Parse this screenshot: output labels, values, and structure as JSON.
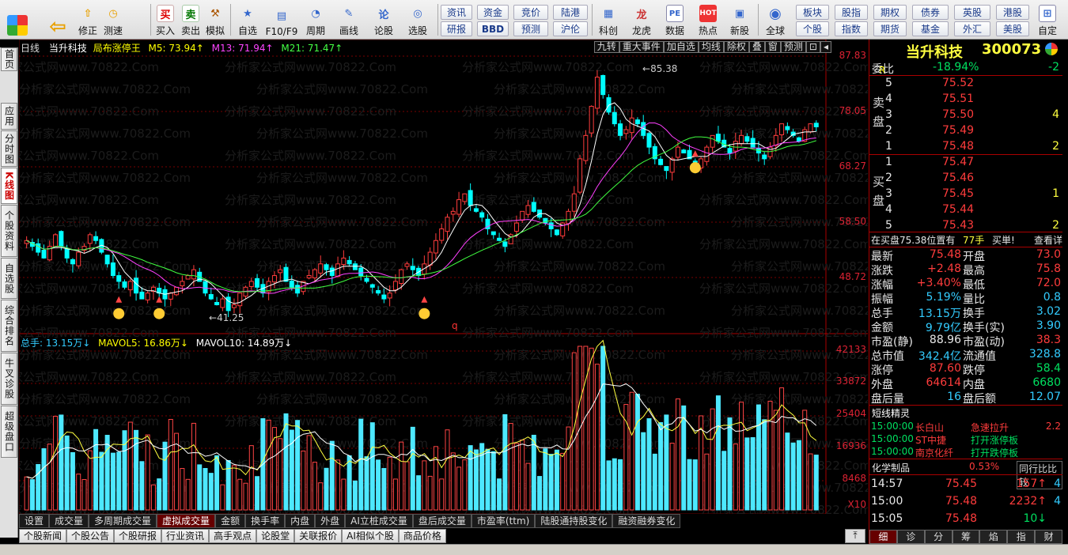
{
  "toolbar": {
    "buttons": [
      {
        "label": "",
        "icon": "logo-icon"
      },
      {
        "label": "",
        "icon": "back-arrow-icon"
      },
      {
        "label": "修正",
        "icon": "up-arrow-icon"
      },
      {
        "label": "测速",
        "icon": "clock-icon"
      },
      {
        "label": "买入",
        "icon": "buy-icon"
      },
      {
        "label": "卖出",
        "icon": "sell-icon"
      },
      {
        "label": "模拟",
        "icon": "hammer-icon"
      },
      {
        "label": "自选",
        "icon": "star-icon"
      },
      {
        "label": "F10/F9",
        "icon": "f10-icon"
      },
      {
        "label": "周期",
        "icon": "cycle-icon"
      },
      {
        "label": "画线",
        "icon": "pencil-icon"
      },
      {
        "label": "论股",
        "icon": "forum-icon"
      },
      {
        "label": "选股",
        "icon": "select-stock-icon"
      },
      {
        "label": "科创",
        "icon": "kechuang-icon"
      },
      {
        "label": "龙虎",
        "icon": "dragon-tiger-icon"
      },
      {
        "label": "数据",
        "icon": "pe-icon"
      },
      {
        "label": "热点",
        "icon": "hot-icon"
      },
      {
        "label": "新股",
        "icon": "ipo-icon"
      },
      {
        "label": "全球",
        "icon": "globe-icon"
      },
      {
        "label": "自定",
        "icon": "custom-icon"
      }
    ],
    "small_top": [
      "资讯",
      "资金",
      "竞价",
      "陆港"
    ],
    "small_bottom": [
      "研报",
      "BBD",
      "预测",
      "沪伦"
    ],
    "right_top": [
      "板块",
      "股指",
      "期权",
      "债券",
      "英股",
      "港股"
    ],
    "right_bottom": [
      "个股",
      "指数",
      "期货",
      "基金",
      "外汇",
      "美股"
    ]
  },
  "lefttabs": [
    "首页",
    "应用",
    "分时图",
    "K线图",
    "个股资料",
    "自选股",
    "综合排名",
    "牛叉诊股",
    "超级盘口"
  ],
  "chart": {
    "period": "日线",
    "stock": "当升科技",
    "indicator": "局布涨停王",
    "ma5": "M5: 73.94↑",
    "ma13": "M13: 71.94↑",
    "ma21": "M21: 71.47↑",
    "buttons": [
      "九转",
      "重大事件",
      "加自选",
      "均线",
      "除权",
      "叠",
      "窗",
      "预测"
    ],
    "price_axis": [
      "87.83",
      "78.05",
      "68.27",
      "58.50",
      "48.72"
    ],
    "vol_axis": [
      "42133",
      "33872",
      "25404",
      "16936",
      "8468",
      "X10"
    ],
    "high_label": "85.38",
    "low_label": "41.25",
    "q_mark": "q",
    "vol_header": {
      "total": "总手: 13.15万↓",
      "mavol5": "MAVOL5: 16.86万↓",
      "mavol10": "MAVOL10: 14.89万↓"
    },
    "watermark": "分析家公式网www.70822.Com",
    "colors": {
      "up": "#ff3c3c",
      "down": "#00ffff",
      "ma5": "#ffffff",
      "ma13": "#ff40ff",
      "ma21": "#40ff40",
      "vol_up": "#ff4444",
      "vol_down": "#4de8ff"
    }
  },
  "chart_data": {
    "type": "candlestick",
    "series_desc": "daily K-line with MA5/MA13/MA21 and volume",
    "ylim": [
      41,
      88
    ],
    "closes": [
      56,
      55,
      54,
      53,
      55,
      57,
      55,
      53,
      52,
      54,
      55,
      57,
      56,
      54,
      52,
      50,
      49,
      48,
      49,
      47,
      46,
      47,
      48,
      47,
      46,
      47,
      48,
      49,
      50,
      51,
      49,
      47,
      46,
      45,
      46,
      44,
      45,
      47,
      48,
      49,
      48,
      47,
      49,
      50,
      51,
      49,
      48,
      47,
      49,
      50,
      51,
      52,
      51,
      50,
      52,
      53,
      52,
      51,
      50,
      49,
      48,
      47,
      46,
      47,
      49,
      51,
      52,
      51,
      50,
      52,
      54,
      56,
      58,
      60,
      61,
      63,
      64,
      62,
      61,
      60,
      58,
      57,
      56,
      55,
      57,
      59,
      61,
      62,
      61,
      60,
      59,
      58,
      57,
      59,
      61,
      64,
      70,
      74,
      79,
      84,
      81,
      78,
      76,
      74,
      75,
      77,
      76,
      74,
      72,
      70,
      69,
      68,
      70,
      72,
      71,
      70,
      69,
      70,
      72,
      74,
      73,
      72,
      71,
      73,
      74,
      73,
      72,
      71,
      70,
      72,
      74,
      76,
      75,
      74,
      73,
      75,
      76,
      75.48
    ],
    "volume_max": 42133
  },
  "rightpanel": {
    "title": "当升科技",
    "code": "300073",
    "r_mark": "R",
    "weibi_label": "委比",
    "weibi": "-18.94%",
    "weibi_right": "-2",
    "sell_label": [
      "卖",
      "盘"
    ],
    "buy_label": [
      "买",
      "盘"
    ],
    "sells": [
      [
        "5",
        "75.52",
        ""
      ],
      [
        "4",
        "75.51",
        ""
      ],
      [
        "3",
        "75.50",
        "4"
      ],
      [
        "2",
        "75.49",
        ""
      ],
      [
        "1",
        "75.48",
        "2"
      ]
    ],
    "buys": [
      [
        "1",
        "75.47",
        ""
      ],
      [
        "2",
        "75.46",
        ""
      ],
      [
        "3",
        "75.45",
        "1"
      ],
      [
        "4",
        "75.44",
        ""
      ],
      [
        "5",
        "75.43",
        "2"
      ]
    ],
    "note": "在买盘75.38位置有",
    "note_hands": "77手",
    "note_buy": "买単!",
    "note_detail": "查看详",
    "stats": [
      [
        "最新",
        "75.48",
        "开盘",
        "73.0"
      ],
      [
        "涨跌",
        "+2.48",
        "最高",
        "75.8"
      ],
      [
        "涨幅",
        "+3.40%",
        "最低",
        "72.0"
      ],
      [
        "振幅",
        "5.19%",
        "量比",
        "0.8"
      ],
      [
        "总手",
        "13.15万",
        "换手",
        "3.02"
      ],
      [
        "金额",
        "9.79亿",
        "换手(实)",
        "3.90"
      ],
      [
        "市盈(静)",
        "88.96",
        "市盈(动)",
        "38.3"
      ],
      [
        "总市值",
        "342.4亿",
        "流通值",
        "328.8"
      ],
      [
        "涨停",
        "87.60",
        "跌停",
        "58.4"
      ],
      [
        "外盘",
        "64614",
        "内盘",
        "6680"
      ],
      [
        "盘后量",
        "16",
        "盘后额",
        "12.07"
      ]
    ],
    "sprite_title": "短线精灵",
    "sprites": [
      [
        "15:00:00",
        "长白山",
        "急速拉升",
        "2.2"
      ],
      [
        "15:00:00",
        "ST中捷",
        "打开涨停板",
        ""
      ],
      [
        "15:00:00",
        "南京化纤",
        "打开跌停板",
        ""
      ]
    ],
    "sector": "化学制品",
    "sector_pct": "0.53%",
    "sector_more": "同行比比较",
    "ticks": [
      [
        "14:57",
        "75.45",
        "157↑",
        "4"
      ],
      [
        "15:00",
        "75.48",
        "2232↑",
        "4"
      ],
      [
        "15:05",
        "75.48",
        "10↓",
        ""
      ]
    ],
    "bottom_tabs": [
      "细",
      "诊",
      "分",
      "筹",
      "焰",
      "指",
      "财"
    ]
  },
  "bottom_tabs_1": [
    "设置",
    "成交量",
    "多周期成交量",
    "虚拟成交量",
    "金额",
    "换手率",
    "内盘",
    "外盘",
    "AI立桩成交量",
    "盘后成交量",
    "市盈率(ttm)",
    "陆股通持股变化",
    "融资融券变化"
  ],
  "bottom_tabs_2": [
    "个股新闻",
    "个股公告",
    "个股研报",
    "行业资讯",
    "高手观点",
    "论股堂",
    "关联报价",
    "AI相似个股",
    "商品价格"
  ]
}
